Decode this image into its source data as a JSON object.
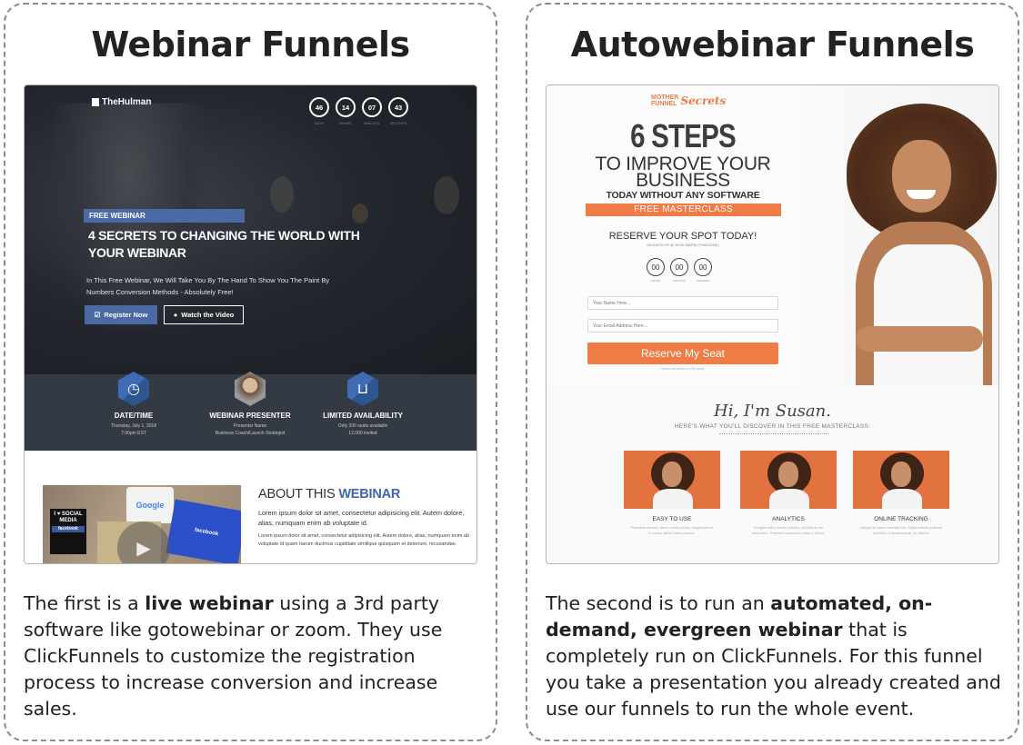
{
  "left": {
    "title": "Webinar Funnels",
    "description_parts": [
      {
        "text": "The first is a ",
        "bold": false
      },
      {
        "text": "live webinar",
        "bold": true
      },
      {
        "text": " using a 3rd party software like gotowebinar or zoom. They use ClickFunnels to customize the registration process to increase conversion and increase sales.",
        "bold": false
      }
    ],
    "preview": {
      "logo": "TheHulman",
      "countdown": [
        {
          "value": "46",
          "label": "DAYS"
        },
        {
          "value": "14",
          "label": "HOURS"
        },
        {
          "value": "07",
          "label": "MINUTES"
        },
        {
          "value": "43",
          "label": "SECONDS"
        }
      ],
      "badge": "FREE WEBINAR",
      "headline": "4 SECRETS TO CHANGING THE WORLD WITH YOUR WEBINAR",
      "subtext": "In This Free Webinar, We Will Take You By The Hand To Show You The Paint By Numbers Conversion Methods - Absolutely Free!",
      "register_button": "Register Now",
      "video_button": "Watch the Video",
      "features": [
        {
          "icon": "clock-icon",
          "glyph": "◷",
          "title": "DATE/TIME",
          "lines": [
            "Thursday, July 1, 2018",
            "7:00pm EST"
          ]
        },
        {
          "icon": "presenter-photo",
          "glyph": "",
          "title": "WEBINAR PRESENTER",
          "lines": [
            "Presenter Name",
            "Business Coach/Launch Strategist"
          ]
        },
        {
          "icon": "seat-icon",
          "glyph": "⊔",
          "title": "LIMITED AVAILABILITY",
          "lines": [
            "Only 200 seats available",
            "12,000 invited"
          ]
        }
      ],
      "about": {
        "title_plain": "ABOUT THIS ",
        "title_highlight": "WEBINAR",
        "para1": "Lorem ipsum dolor sit amet, consectetur adipisicing elit. Autem dolore, alias, numquam enim ab voluptate id.",
        "para2": "Lorem ipsum dolor sit amet, consectetur adipisicing elit. Autem dolore, alias, numquam enim ab voluptate id quam harum ducimus cupiditate similique quisquam et deserunt, recusandae.",
        "image_texts": {
          "social": "I ♥ SOCIAL MEDIA",
          "facebook_tag": "facebook",
          "google": "Google",
          "facebook_card": "facebook"
        }
      }
    }
  },
  "right": {
    "title": "Autowebinar Funnels",
    "description_parts": [
      {
        "text": "The second is to run an ",
        "bold": false
      },
      {
        "text": "automated, on-demand, evergreen webinar",
        "bold": true
      },
      {
        "text": " that is completely run on ClickFunnels. For this funnel you take a presentation you already created and use our funnels to run the whole event.",
        "bold": false
      }
    ],
    "preview": {
      "logo_line1": "MOTHER",
      "logo_line2": "FUNNEL",
      "logo_script": "Secrets",
      "headline_big": "6 STEPS",
      "headline_mid": "TO IMPROVE YOUR BUSINESS",
      "headline_small": "TODAY WITHOUT ANY SOFTWARE",
      "masterclass_banner": "FREE MASTERCLASS",
      "reserve_heading": "RESERVE YOUR SPOT TODAY!",
      "date_line": "MO/DATE/YR @ 00:00 AM/PM (TIMEZONE)",
      "countdown": [
        {
          "value": "00",
          "label": "HOURS"
        },
        {
          "value": "00",
          "label": "MINUTES"
        },
        {
          "value": "00",
          "label": "SECONDS"
        }
      ],
      "name_placeholder": "Your Name Here...",
      "email_placeholder": "Your Email Address Here...",
      "button_label": "Reserve My Seat",
      "note": "*Seats are limited to 200 spots.",
      "greeting": "Hi, I'm Susan.",
      "discover": "HERE'S WHAT YOU'LL DISCOVER IN THIS FREE MASTERCLASS:",
      "features": [
        {
          "title": "EASY TO USE",
          "text": "Praesent semper, lacus cursus porta, feugiat primis in luctus ultrice tellus potenti."
        },
        {
          "title": "ANALYTICS",
          "text": "Feugiat erat a ipsum viverra, vel finibus est bibendum. Praesent commodo dolor a lorem."
        },
        {
          "title": "ONLINE TRACKING",
          "text": "Integer sit amet molestie ain. Suspendisse pulvinar sed felis ut iaculisneque, at ultrices."
        }
      ]
    }
  },
  "colors": {
    "webinar_blue": "#4b6aa3",
    "hero_dark": "#23272e",
    "feature_band": "#343a43",
    "accent_orange": "#ef7b45",
    "border_dashed": "#8c8c8c"
  }
}
